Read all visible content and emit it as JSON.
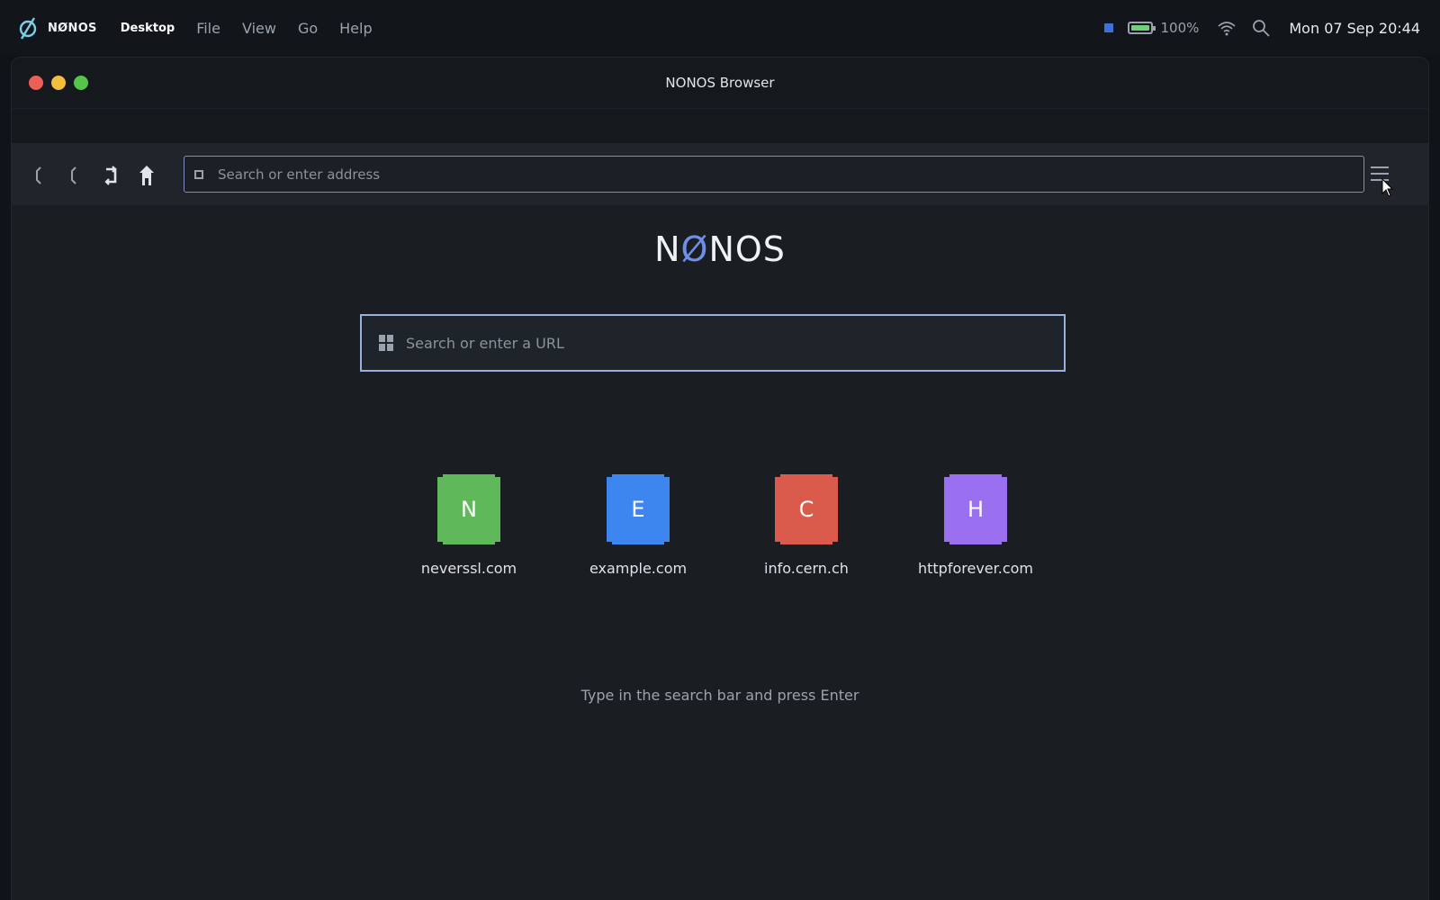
{
  "menubar": {
    "brand": "NØNOS",
    "items": [
      {
        "label": "Desktop",
        "active": true
      },
      {
        "label": "File"
      },
      {
        "label": "View"
      },
      {
        "label": "Go"
      },
      {
        "label": "Help"
      }
    ],
    "battery_percent": 100,
    "battery_text": "100%",
    "clock": "Mon 07 Sep  20:44"
  },
  "window": {
    "title": "NONOS Browser"
  },
  "toolbar": {
    "address_placeholder": "Search or enter address",
    "address_value": ""
  },
  "home": {
    "logo_left": "N",
    "logo_slash": "Ø",
    "logo_right": "NOS",
    "search_placeholder": "Search or enter a URL",
    "tiles": [
      {
        "letter": "N",
        "label": "neverssl.com",
        "color": "#5fb85a"
      },
      {
        "letter": "E",
        "label": "example.com",
        "color": "#3d86f0"
      },
      {
        "letter": "C",
        "label": "info.cern.ch",
        "color": "#da5a4c"
      },
      {
        "letter": "H",
        "label": "httpforever.com",
        "color": "#9a6ff0"
      }
    ],
    "hint": "Type in the search bar and press Enter"
  },
  "colors": {
    "accent": "#6f8ee8",
    "border_focus": "#9aafde"
  }
}
